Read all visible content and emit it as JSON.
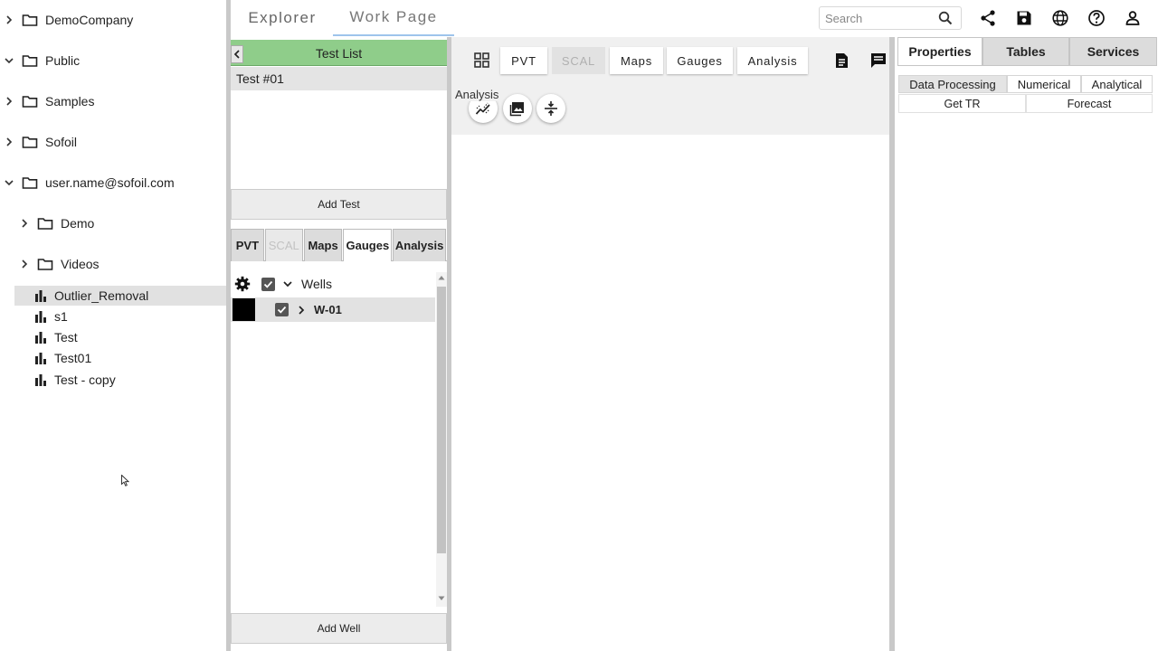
{
  "explorer_tree": {
    "folders": [
      {
        "label": "DemoCompany",
        "expanded": false
      },
      {
        "label": "Public",
        "expanded": true
      },
      {
        "label": "Samples",
        "expanded": false
      },
      {
        "label": "Sofoil",
        "expanded": false
      },
      {
        "label": "user.name@sofoil.com",
        "expanded": true
      },
      {
        "label": "Demo",
        "expanded": false
      },
      {
        "label": "Videos",
        "expanded": false
      }
    ],
    "files": [
      {
        "label": "Outlier_Removal",
        "selected": true
      },
      {
        "label": "s1",
        "selected": false
      },
      {
        "label": "Test",
        "selected": false
      },
      {
        "label": "Test01",
        "selected": false
      },
      {
        "label": "Test - copy",
        "selected": false
      }
    ]
  },
  "header": {
    "tabs": [
      {
        "label": "Explorer",
        "active": false
      },
      {
        "label": "Work Page",
        "active": true
      }
    ],
    "search_placeholder": "Search",
    "icons": [
      "search-icon",
      "share-icon",
      "save-icon",
      "globe-icon",
      "help-icon",
      "user-icon"
    ]
  },
  "test_list": {
    "title": "Test List",
    "tests": [
      "Test #01"
    ],
    "add_test_label": "Add Test",
    "tabs": [
      {
        "label": "PVT",
        "state": "normal"
      },
      {
        "label": "SCAL",
        "state": "disabled"
      },
      {
        "label": "Maps",
        "state": "normal"
      },
      {
        "label": "Gauges",
        "state": "active"
      },
      {
        "label": "Analysis",
        "state": "normal"
      }
    ],
    "wells_group_label": "Wells",
    "wells": [
      {
        "label": "W-01",
        "color": "#000000",
        "checked": true
      }
    ],
    "add_well_label": "Add Well"
  },
  "work_area": {
    "tabs": [
      {
        "label": "PVT",
        "state": "normal"
      },
      {
        "label": "SCAL",
        "state": "disabled"
      },
      {
        "label": "Maps",
        "state": "normal"
      },
      {
        "label": "Gauges",
        "state": "normal"
      },
      {
        "label": "Analysis",
        "state": "normal"
      }
    ],
    "tooltip": "Analysis",
    "tool_icons": [
      "analysis-chart-icon",
      "image-icon",
      "vertical-align-center-icon"
    ]
  },
  "properties": {
    "tabs": [
      {
        "label": "Properties",
        "active": true
      },
      {
        "label": "Tables",
        "active": false
      },
      {
        "label": "Services",
        "active": false
      }
    ],
    "category_tabs": [
      {
        "label": "Data Processing",
        "active": true
      },
      {
        "label": "Numerical",
        "active": false
      },
      {
        "label": "Analytical",
        "active": false
      }
    ],
    "actions": [
      "Get TR",
      "Forecast"
    ]
  },
  "colors": {
    "test_list_header": "#8fcd8a",
    "selected_row": "#e1e1e1",
    "active_tab_underline": "#9ec4ec"
  }
}
